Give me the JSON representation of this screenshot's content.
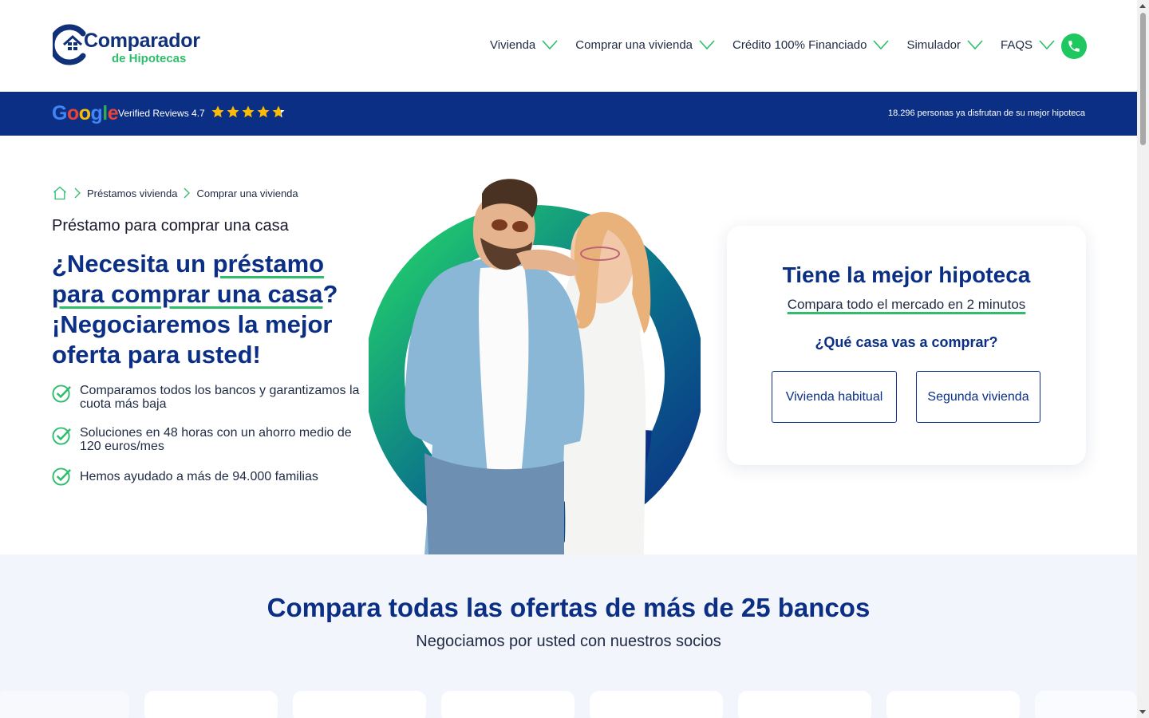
{
  "header": {
    "logo_main": "Comparador",
    "logo_sub": "de Hipotecas",
    "nav": [
      {
        "label": "Vivienda"
      },
      {
        "label": "Comprar una vivienda"
      },
      {
        "label": "Crédito 100% Financiado"
      },
      {
        "label": "Simulador"
      },
      {
        "label": "FAQS"
      }
    ],
    "phone_icon": "phone-icon"
  },
  "bluebar": {
    "google_letters": [
      "G",
      "o",
      "o",
      "g",
      "l",
      "e"
    ],
    "google_colors": [
      "#4285F4",
      "#EA4335",
      "#FBBC05",
      "#4285F4",
      "#34A853",
      "#EA4335"
    ],
    "verified": "Verified Reviews 4.7",
    "stars": 4.7,
    "persons": "18.296 personas ya disfrutan de su mejor hipoteca"
  },
  "hero": {
    "breadcrumb": [
      "Préstamos vivienda",
      "Comprar una vivienda"
    ],
    "subtitle": "Préstamo para comprar una casa",
    "headline_pre": "¿Necesita un ",
    "headline_ul1": "préstamo",
    "headline_ul2": "para comprar una casa",
    "headline_post": "? ¡Negociaremos la mejor oferta para usted!",
    "benefits": [
      "Comparamos todos los bancos y garantizamos la cuota más baja",
      "Soluciones en 48 horas con un ahorro medio de 120 euros/mes",
      "Hemos ayudado a más de 94.000 familias"
    ]
  },
  "card": {
    "title": "Tiene la mejor hipoteca",
    "subtitle": "Compara todo el mercado en 2 minutos",
    "question": "¿Qué casa vas a comprar?",
    "buttons": [
      "Vivienda habitual",
      "Segunda vivienda"
    ]
  },
  "banks": {
    "title_pre": "Compara todas las ofertas de ",
    "title_bold": "más de 25 bancos",
    "subtitle": "Negociamos por usted con nuestros socios"
  },
  "colors": {
    "brand_blue": "#0b2f84",
    "brand_green": "#2ebd6b",
    "phone_green": "#1ec760"
  }
}
